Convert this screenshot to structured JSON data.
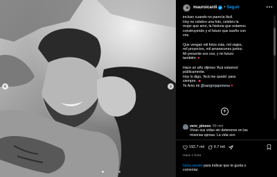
{
  "post": {
    "username": "mauroicardi",
    "separator": "•",
    "follow_label": "Seguir"
  },
  "caption": {
    "line1": "incluso cuando no parecía fácil.",
    "line2": "Hoy no celebro una foto, celebro la",
    "line3": "mujer que amo, la historia que estamos",
    "line4": "construyendo y el futuro que sueño con",
    "line5": "vos.",
    "line6": "Que vengan mil fotos más, mil viajes,",
    "line7": "mil proyectos, mil amaneceres juntos.",
    "line8": "Mi presente sos vos, y mi futuro",
    "line9_text": "también.",
    "line9_emoji": "♥",
    "line10": "Hace un año dijimos 'Acá estamos'",
    "line11": "públicamente.",
    "line12": "Hoy lo digo, 'Acá me quedo' para",
    "line13_text": "siempre.",
    "line13_emoji": "☻",
    "line14_prefix": "Te Amo mi",
    "line14_mention": "@sangrejaponesa",
    "line14_emoji": "♥"
  },
  "load_more_symbol": "+",
  "comment": {
    "username": "vero_pinooc",
    "time": "49 min",
    "text1": "Vivan sus vidas sin detenerse en las",
    "text2": "miserias ajenas. La vida son"
  },
  "actions": {
    "likes": "192.7 mil",
    "comments": "6.7 mil"
  },
  "date": "Hace 1 hora",
  "login": {
    "link": "Inicia sesión",
    "text": " para indicar que te gusta o",
    "text2": "comentar."
  },
  "carousel": {
    "total": 16,
    "active_index": 11
  },
  "colors": {
    "accent": "#0095f6",
    "heart": "#ff3b6b",
    "background": "#000000"
  },
  "icons": [
    "verified-badge-icon",
    "more-options-icon",
    "heart-icon",
    "comment-icon",
    "share-icon",
    "bookmark-icon",
    "plus-circle-icon",
    "chevron-left-icon",
    "chevron-right-icon"
  ]
}
